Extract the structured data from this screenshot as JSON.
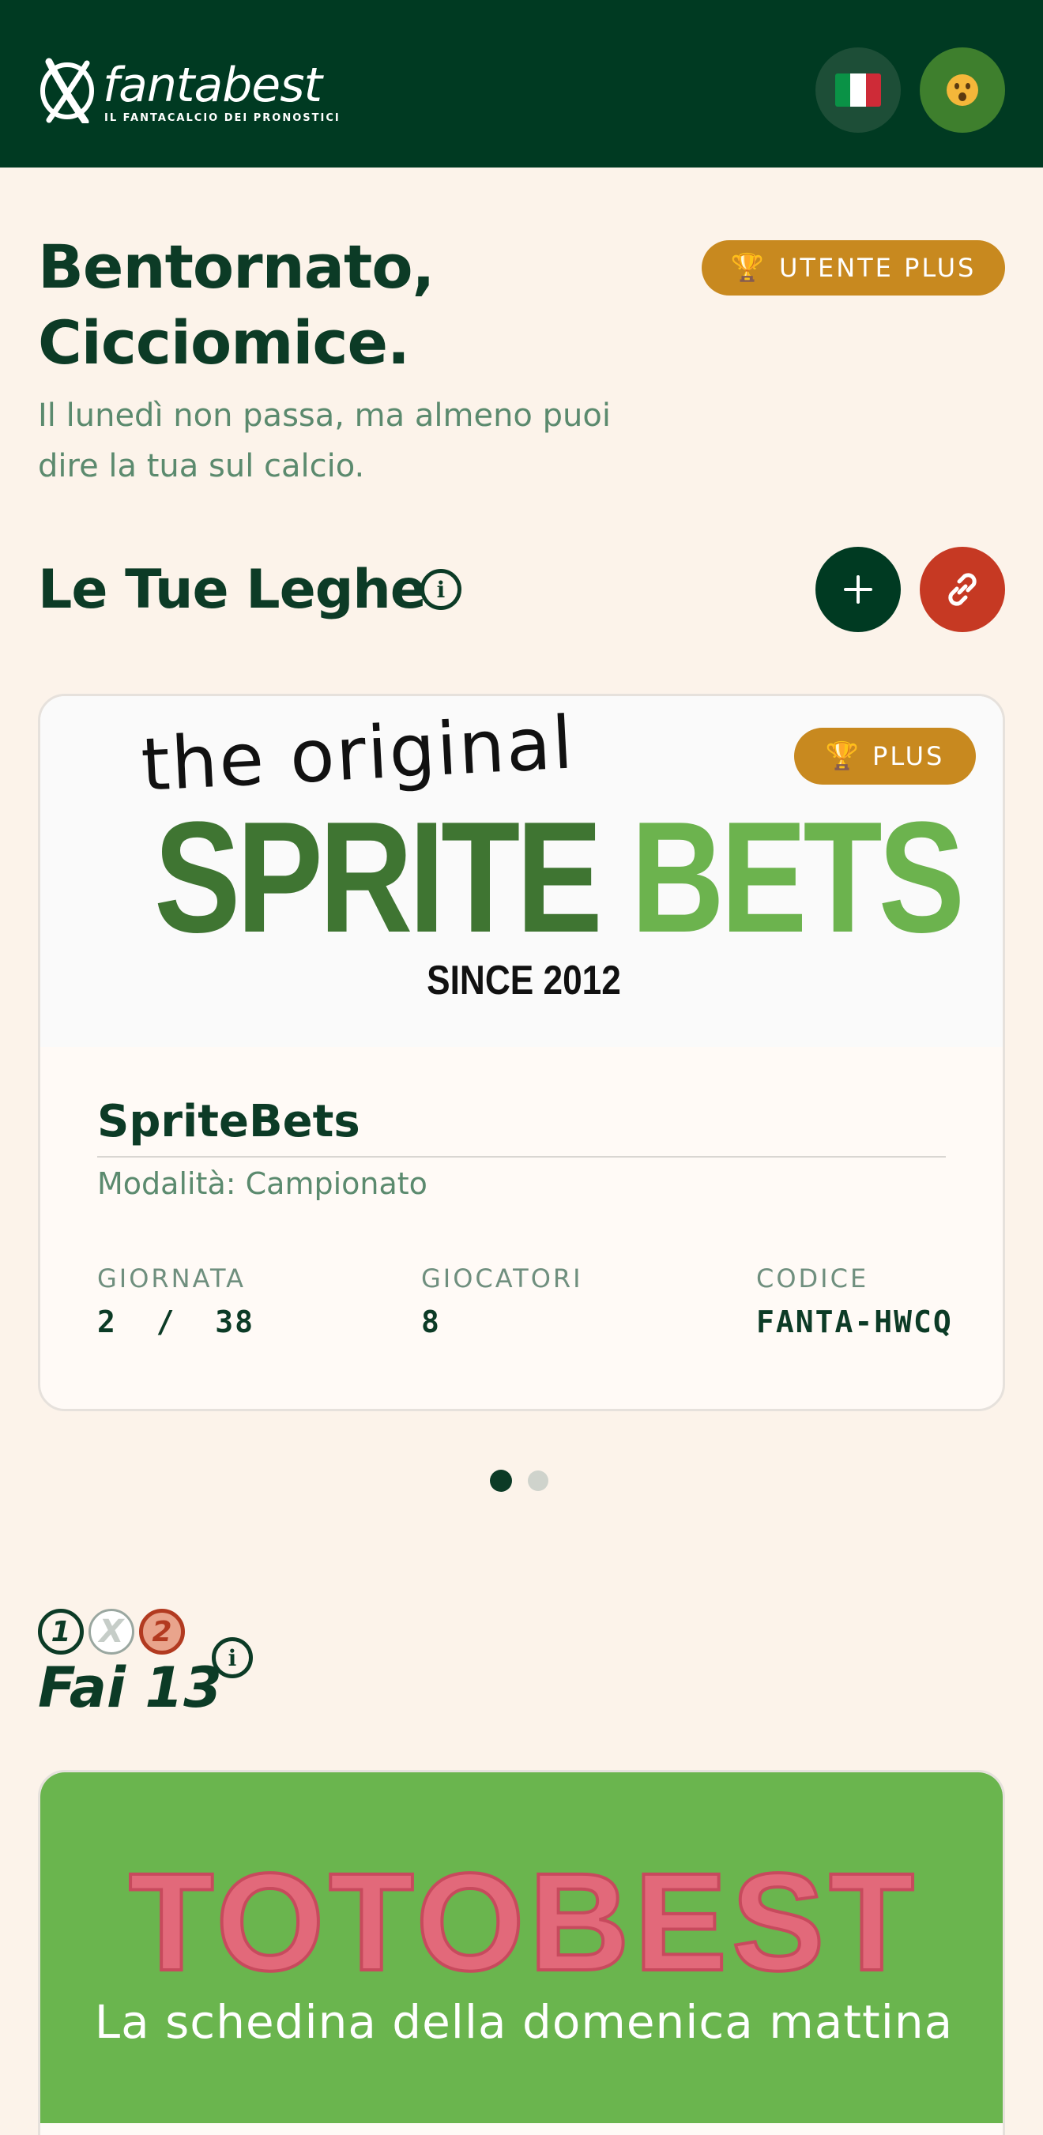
{
  "header": {
    "logo_word": "fantabest",
    "logo_tagline": "IL FANTACALCIO DEI PRONOSTICI",
    "language_icon": "italy-flag-icon",
    "avatar_icon": "astonished-face-icon"
  },
  "greeting": {
    "title_line1": "Bentornato,",
    "title_line2": "Cicciomice.",
    "subtitle_line1": "Il lunedì non passa, ma almeno puoi",
    "subtitle_line2": "dire la tua sul calcio.",
    "plus_badge": "UTENTE PLUS"
  },
  "leagues": {
    "section_title": "Le Tue Leghe",
    "add_icon": "plus-icon",
    "join_icon": "link-icon",
    "cards": [
      {
        "banner": {
          "script": "the original",
          "word1": "SPRITE",
          "word2": "BETS",
          "since": "SINCE 2012"
        },
        "badge": "PLUS",
        "name": "SpriteBets",
        "mode": "Modalità: Campionato",
        "round_label": "GIORNATA",
        "round_value": "2  /  38",
        "players_label": "GIOCATORI",
        "players_value": "8",
        "code_label": "CODICE",
        "code_value": "FANTA-HWCQ"
      }
    ],
    "pagination": {
      "current": 1,
      "total": 2
    }
  },
  "fai13": {
    "icons": [
      "1",
      "X",
      "2"
    ],
    "title": "Fai 13",
    "banner_title": "TOTOBEST",
    "banner_subtitle": "La schedina della domenica mattina"
  },
  "colors": {
    "header_bg": "#003a22",
    "page_bg": "#fcf3ea",
    "brand_dark": "#0c3b26",
    "gold": "#c8891f",
    "red": "#c63923",
    "green": "#6ab54e"
  }
}
